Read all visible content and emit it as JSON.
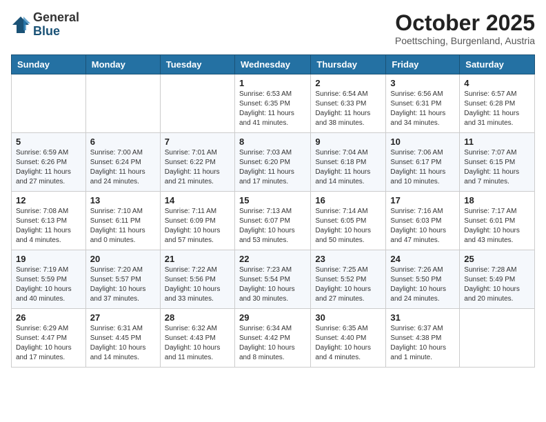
{
  "header": {
    "logo_general": "General",
    "logo_blue": "Blue",
    "month_title": "October 2025",
    "location": "Poettsching, Burgenland, Austria"
  },
  "days_of_week": [
    "Sunday",
    "Monday",
    "Tuesday",
    "Wednesday",
    "Thursday",
    "Friday",
    "Saturday"
  ],
  "weeks": [
    [
      {
        "day": "",
        "info": ""
      },
      {
        "day": "",
        "info": ""
      },
      {
        "day": "",
        "info": ""
      },
      {
        "day": "1",
        "info": "Sunrise: 6:53 AM\nSunset: 6:35 PM\nDaylight: 11 hours\nand 41 minutes."
      },
      {
        "day": "2",
        "info": "Sunrise: 6:54 AM\nSunset: 6:33 PM\nDaylight: 11 hours\nand 38 minutes."
      },
      {
        "day": "3",
        "info": "Sunrise: 6:56 AM\nSunset: 6:31 PM\nDaylight: 11 hours\nand 34 minutes."
      },
      {
        "day": "4",
        "info": "Sunrise: 6:57 AM\nSunset: 6:28 PM\nDaylight: 11 hours\nand 31 minutes."
      }
    ],
    [
      {
        "day": "5",
        "info": "Sunrise: 6:59 AM\nSunset: 6:26 PM\nDaylight: 11 hours\nand 27 minutes."
      },
      {
        "day": "6",
        "info": "Sunrise: 7:00 AM\nSunset: 6:24 PM\nDaylight: 11 hours\nand 24 minutes."
      },
      {
        "day": "7",
        "info": "Sunrise: 7:01 AM\nSunset: 6:22 PM\nDaylight: 11 hours\nand 21 minutes."
      },
      {
        "day": "8",
        "info": "Sunrise: 7:03 AM\nSunset: 6:20 PM\nDaylight: 11 hours\nand 17 minutes."
      },
      {
        "day": "9",
        "info": "Sunrise: 7:04 AM\nSunset: 6:18 PM\nDaylight: 11 hours\nand 14 minutes."
      },
      {
        "day": "10",
        "info": "Sunrise: 7:06 AM\nSunset: 6:17 PM\nDaylight: 11 hours\nand 10 minutes."
      },
      {
        "day": "11",
        "info": "Sunrise: 7:07 AM\nSunset: 6:15 PM\nDaylight: 11 hours\nand 7 minutes."
      }
    ],
    [
      {
        "day": "12",
        "info": "Sunrise: 7:08 AM\nSunset: 6:13 PM\nDaylight: 11 hours\nand 4 minutes."
      },
      {
        "day": "13",
        "info": "Sunrise: 7:10 AM\nSunset: 6:11 PM\nDaylight: 11 hours\nand 0 minutes."
      },
      {
        "day": "14",
        "info": "Sunrise: 7:11 AM\nSunset: 6:09 PM\nDaylight: 10 hours\nand 57 minutes."
      },
      {
        "day": "15",
        "info": "Sunrise: 7:13 AM\nSunset: 6:07 PM\nDaylight: 10 hours\nand 53 minutes."
      },
      {
        "day": "16",
        "info": "Sunrise: 7:14 AM\nSunset: 6:05 PM\nDaylight: 10 hours\nand 50 minutes."
      },
      {
        "day": "17",
        "info": "Sunrise: 7:16 AM\nSunset: 6:03 PM\nDaylight: 10 hours\nand 47 minutes."
      },
      {
        "day": "18",
        "info": "Sunrise: 7:17 AM\nSunset: 6:01 PM\nDaylight: 10 hours\nand 43 minutes."
      }
    ],
    [
      {
        "day": "19",
        "info": "Sunrise: 7:19 AM\nSunset: 5:59 PM\nDaylight: 10 hours\nand 40 minutes."
      },
      {
        "day": "20",
        "info": "Sunrise: 7:20 AM\nSunset: 5:57 PM\nDaylight: 10 hours\nand 37 minutes."
      },
      {
        "day": "21",
        "info": "Sunrise: 7:22 AM\nSunset: 5:56 PM\nDaylight: 10 hours\nand 33 minutes."
      },
      {
        "day": "22",
        "info": "Sunrise: 7:23 AM\nSunset: 5:54 PM\nDaylight: 10 hours\nand 30 minutes."
      },
      {
        "day": "23",
        "info": "Sunrise: 7:25 AM\nSunset: 5:52 PM\nDaylight: 10 hours\nand 27 minutes."
      },
      {
        "day": "24",
        "info": "Sunrise: 7:26 AM\nSunset: 5:50 PM\nDaylight: 10 hours\nand 24 minutes."
      },
      {
        "day": "25",
        "info": "Sunrise: 7:28 AM\nSunset: 5:49 PM\nDaylight: 10 hours\nand 20 minutes."
      }
    ],
    [
      {
        "day": "26",
        "info": "Sunrise: 6:29 AM\nSunset: 4:47 PM\nDaylight: 10 hours\nand 17 minutes."
      },
      {
        "day": "27",
        "info": "Sunrise: 6:31 AM\nSunset: 4:45 PM\nDaylight: 10 hours\nand 14 minutes."
      },
      {
        "day": "28",
        "info": "Sunrise: 6:32 AM\nSunset: 4:43 PM\nDaylight: 10 hours\nand 11 minutes."
      },
      {
        "day": "29",
        "info": "Sunrise: 6:34 AM\nSunset: 4:42 PM\nDaylight: 10 hours\nand 8 minutes."
      },
      {
        "day": "30",
        "info": "Sunrise: 6:35 AM\nSunset: 4:40 PM\nDaylight: 10 hours\nand 4 minutes."
      },
      {
        "day": "31",
        "info": "Sunrise: 6:37 AM\nSunset: 4:38 PM\nDaylight: 10 hours\nand 1 minute."
      },
      {
        "day": "",
        "info": ""
      }
    ]
  ]
}
